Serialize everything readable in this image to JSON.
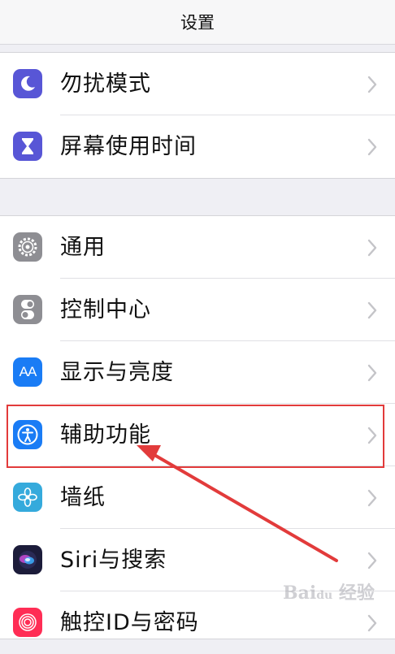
{
  "navbar": {
    "title": "设置"
  },
  "group1": {
    "items": [
      {
        "label": "勿扰模式",
        "icon": "moon-icon",
        "color": "#5856d6"
      },
      {
        "label": "屏幕使用时间",
        "icon": "hourglass-icon",
        "color": "#5856d6"
      }
    ]
  },
  "group2": {
    "items": [
      {
        "label": "通用",
        "icon": "gear-icon",
        "color": "#8e8e93"
      },
      {
        "label": "控制中心",
        "icon": "toggles-icon",
        "color": "#8e8e93"
      },
      {
        "label": "显示与亮度",
        "icon": "text-size-icon",
        "color": "#1a7cf5"
      },
      {
        "label": "辅助功能",
        "icon": "accessibility-icon",
        "color": "#1a7cf5"
      },
      {
        "label": "墙纸",
        "icon": "flower-icon",
        "color": "#35aadc"
      },
      {
        "label": "Siri与搜索",
        "icon": "siri-icon",
        "color": "#1c1c3a"
      },
      {
        "label": "触控ID与密码",
        "icon": "fingerprint-icon",
        "color": "#ff2d55"
      }
    ]
  },
  "annotation": {
    "highlight_color": "#e23b3b",
    "highlighted_item": "辅助功能"
  },
  "watermark": {
    "text": "Baidu 经验"
  }
}
